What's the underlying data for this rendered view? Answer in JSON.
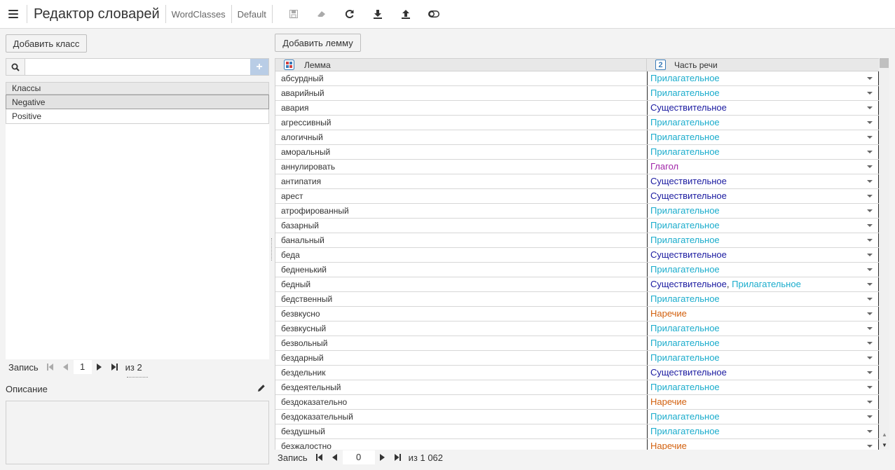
{
  "toolbar": {
    "title": "Редактор словарей",
    "breadcrumb_1": "WordClasses",
    "breadcrumb_2": "Default"
  },
  "left": {
    "add_class_label": "Добавить класс",
    "search_value": "",
    "list_header": "Классы",
    "classes": [
      {
        "name": "Negative",
        "selected": true
      },
      {
        "name": "Positive",
        "selected": false
      }
    ],
    "pager": {
      "label": "Запись",
      "current": "1",
      "of": "из 2"
    },
    "description_label": "Описание"
  },
  "grid": {
    "add_lemma_label": "Добавить лемму",
    "col_lemma": "Лемма",
    "col_pos_badge": "2",
    "col_pos": "Часть речи",
    "rows": [
      {
        "lemma": "абсурдный",
        "pos": [
          {
            "text": "Прилагательное",
            "kind": "adj"
          }
        ]
      },
      {
        "lemma": "аварийный",
        "pos": [
          {
            "text": "Прилагательное",
            "kind": "adj"
          }
        ]
      },
      {
        "lemma": "авария",
        "pos": [
          {
            "text": "Существительное",
            "kind": "noun"
          }
        ]
      },
      {
        "lemma": "агрессивный",
        "pos": [
          {
            "text": "Прилагательное",
            "kind": "adj"
          }
        ]
      },
      {
        "lemma": "алогичный",
        "pos": [
          {
            "text": "Прилагательное",
            "kind": "adj"
          }
        ]
      },
      {
        "lemma": "аморальный",
        "pos": [
          {
            "text": "Прилагательное",
            "kind": "adj"
          }
        ]
      },
      {
        "lemma": "аннулировать",
        "pos": [
          {
            "text": "Глагол",
            "kind": "verb"
          }
        ]
      },
      {
        "lemma": "антипатия",
        "pos": [
          {
            "text": "Существительное",
            "kind": "noun"
          }
        ]
      },
      {
        "lemma": "арест",
        "pos": [
          {
            "text": "Существительное",
            "kind": "noun"
          }
        ]
      },
      {
        "lemma": "атрофированный",
        "pos": [
          {
            "text": "Прилагательное",
            "kind": "adj"
          }
        ]
      },
      {
        "lemma": "базарный",
        "pos": [
          {
            "text": "Прилагательное",
            "kind": "adj"
          }
        ]
      },
      {
        "lemma": "банальный",
        "pos": [
          {
            "text": "Прилагательное",
            "kind": "adj"
          }
        ]
      },
      {
        "lemma": "беда",
        "pos": [
          {
            "text": "Существительное",
            "kind": "noun"
          }
        ]
      },
      {
        "lemma": "бедненький",
        "pos": [
          {
            "text": "Прилагательное",
            "kind": "adj"
          }
        ]
      },
      {
        "lemma": "бедный",
        "pos": [
          {
            "text": "Существительное",
            "kind": "noun"
          },
          {
            "text": "Прилагательное",
            "kind": "adj"
          }
        ]
      },
      {
        "lemma": "бедственный",
        "pos": [
          {
            "text": "Прилагательное",
            "kind": "adj"
          }
        ]
      },
      {
        "lemma": "безвкусно",
        "pos": [
          {
            "text": "Наречие",
            "kind": "adv"
          }
        ]
      },
      {
        "lemma": "безвкусный",
        "pos": [
          {
            "text": "Прилагательное",
            "kind": "adj"
          }
        ]
      },
      {
        "lemma": "безвольный",
        "pos": [
          {
            "text": "Прилагательное",
            "kind": "adj"
          }
        ]
      },
      {
        "lemma": "бездарный",
        "pos": [
          {
            "text": "Прилагательное",
            "kind": "adj"
          }
        ]
      },
      {
        "lemma": "бездельник",
        "pos": [
          {
            "text": "Существительное",
            "kind": "noun"
          }
        ]
      },
      {
        "lemma": "бездеятельный",
        "pos": [
          {
            "text": "Прилагательное",
            "kind": "adj"
          }
        ]
      },
      {
        "lemma": "бездоказательно",
        "pos": [
          {
            "text": "Наречие",
            "kind": "adv"
          }
        ]
      },
      {
        "lemma": "бездоказательный",
        "pos": [
          {
            "text": "Прилагательное",
            "kind": "adj"
          }
        ]
      },
      {
        "lemma": "бездушный",
        "pos": [
          {
            "text": "Прилагательное",
            "kind": "adj"
          }
        ]
      },
      {
        "lemma": "безжалостно",
        "pos": [
          {
            "text": "Наречие",
            "kind": "adv"
          }
        ]
      }
    ],
    "pager": {
      "label": "Запись",
      "current": "0",
      "of": "из 1 062"
    }
  },
  "colors": {
    "adj": "#1aaccc",
    "noun": "#1a1aa0",
    "verb": "#a024a8",
    "adv": "#d2600e"
  }
}
